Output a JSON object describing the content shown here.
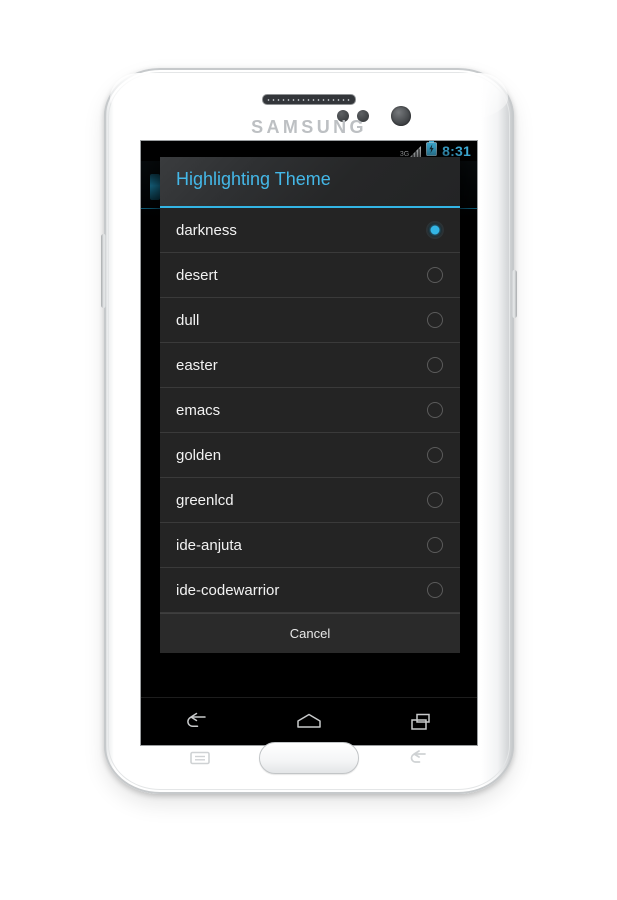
{
  "device": {
    "brand": "SAMSUNG",
    "hardware": {
      "earpiece": "earpiece-speaker",
      "front_camera": "front-camera-icon",
      "proximity_sensor": "proximity-sensor-icon",
      "light_sensor": "light-sensor-icon",
      "home_button": "home-button",
      "menu_key": "menu-key-icon",
      "back_key": "back-key-icon",
      "volume_button": "volume-rocker",
      "power_button": "power-button"
    }
  },
  "colors": {
    "accent": "#33b5e5",
    "title_text": "#44b8e8",
    "clock": "#42b8e6",
    "dialog_bg": "#242424",
    "divider": "#3a3a3a",
    "screen_bg": "#000000",
    "radio_unchecked": "#5b5b5b"
  },
  "status_bar": {
    "network_type": "3G",
    "signal_icon": "signal-bars-icon",
    "battery_icon": "battery-charging-icon",
    "clock": "8:31"
  },
  "dialog": {
    "title": "Highlighting Theme",
    "selected_value": "darkness",
    "items": [
      {
        "label": "darkness",
        "selected": true
      },
      {
        "label": "desert",
        "selected": false
      },
      {
        "label": "dull",
        "selected": false
      },
      {
        "label": "easter",
        "selected": false
      },
      {
        "label": "emacs",
        "selected": false
      },
      {
        "label": "golden",
        "selected": false
      },
      {
        "label": "greenlcd",
        "selected": false
      },
      {
        "label": "ide-anjuta",
        "selected": false
      },
      {
        "label": "ide-codewarrior",
        "selected": false
      }
    ],
    "cancel_label": "Cancel"
  },
  "nav_bar": {
    "back": "back-icon",
    "home": "home-icon",
    "recents": "recent-apps-icon"
  }
}
